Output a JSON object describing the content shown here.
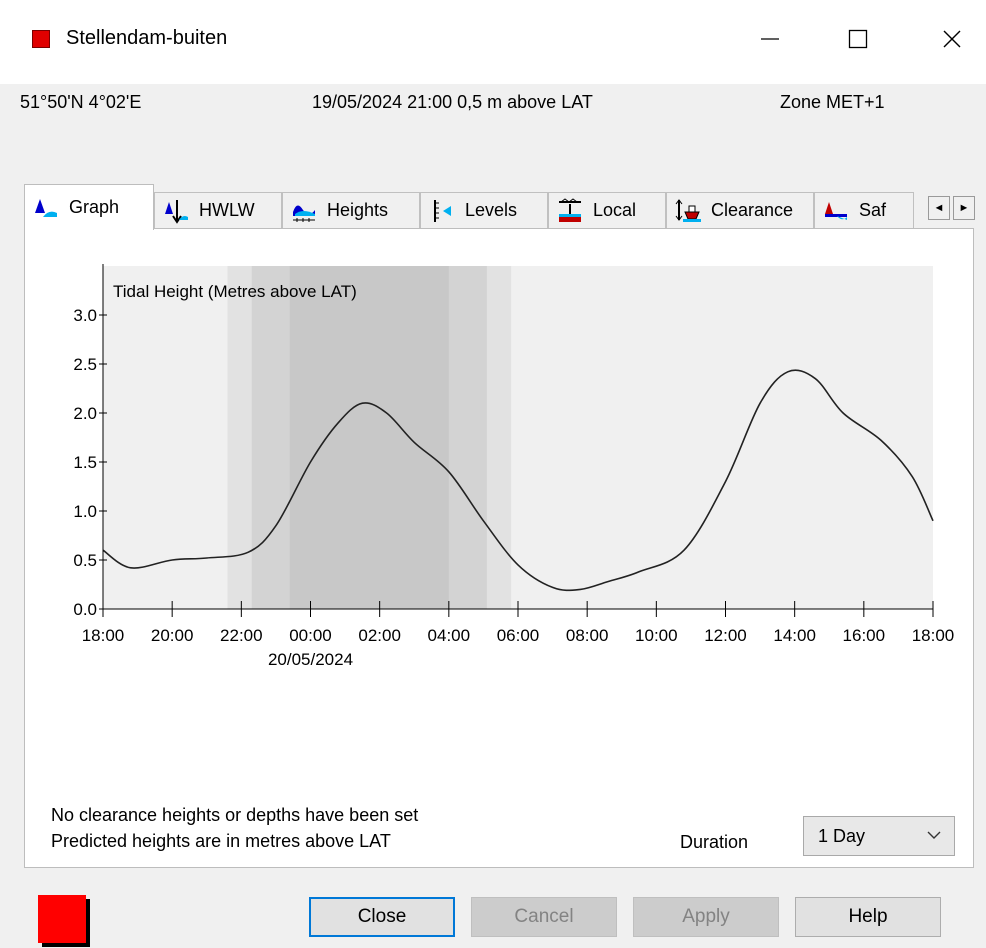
{
  "window": {
    "title": "Stellendam-buiten",
    "controls": {
      "minimize": "—",
      "maximize": "☐",
      "close": "✕"
    }
  },
  "info": {
    "position": "51°50'N 4°02'E",
    "datetime_height": "19/05/2024 21:00  0,5 m above LAT",
    "zone": "Zone  MET+1"
  },
  "tabs": [
    {
      "label": "Graph",
      "icon": "graph-icon",
      "active": true
    },
    {
      "label": "HWLW",
      "icon": "hwlw-icon"
    },
    {
      "label": "Heights",
      "icon": "heights-icon"
    },
    {
      "label": "Levels",
      "icon": "levels-icon"
    },
    {
      "label": "Local",
      "icon": "local-icon"
    },
    {
      "label": "Clearance",
      "icon": "clearance-icon"
    },
    {
      "label": "Saf",
      "icon": "safety-icon"
    }
  ],
  "tab_scroll": {
    "left": "◄",
    "right": "►"
  },
  "chart_data": {
    "type": "line",
    "title": "Tidal Height (Metres above LAT)",
    "ylim": [
      0,
      3.5
    ],
    "yticks": [
      "0.0",
      "0.5",
      "1.0",
      "1.5",
      "2.0",
      "2.5",
      "3.0"
    ],
    "ytick_values": [
      0,
      0.5,
      1.0,
      1.5,
      2.0,
      2.5,
      3.0
    ],
    "xlim": [
      0,
      24
    ],
    "xticks": [
      "18:00",
      "20:00",
      "22:00",
      "00:00",
      "02:00",
      "04:00",
      "06:00",
      "08:00",
      "10:00",
      "12:00",
      "14:00",
      "16:00",
      "18:00"
    ],
    "xtick_values": [
      0,
      2,
      4,
      6,
      8,
      10,
      12,
      14,
      16,
      18,
      20,
      22,
      24
    ],
    "date_label": "20/05/2024",
    "date_label_hours": 6,
    "shading_bands": [
      {
        "from_hours": 3.6,
        "to_hours": 11.8,
        "level": "light"
      },
      {
        "from_hours": 4.3,
        "to_hours": 11.1,
        "level": "medium"
      },
      {
        "from_hours": 5.4,
        "to_hours": 10.0,
        "level": "dark"
      }
    ],
    "grid": false,
    "series": [
      {
        "x_hours": [
          0,
          0.8,
          2,
          3,
          4.2,
          5,
          6,
          6.8,
          7.5,
          8.2,
          9,
          10,
          11,
          12,
          13,
          13.8,
          14.6,
          15.5,
          16.8,
          18,
          19,
          19.8,
          20.6,
          21.4,
          22.5,
          23.4,
          24
        ],
        "values": [
          0.6,
          0.42,
          0.5,
          0.52,
          0.58,
          0.85,
          1.5,
          1.9,
          2.1,
          2.0,
          1.7,
          1.4,
          0.9,
          0.45,
          0.22,
          0.2,
          0.28,
          0.38,
          0.6,
          1.3,
          2.1,
          2.42,
          2.35,
          2.0,
          1.72,
          1.35,
          0.9
        ]
      }
    ],
    "colors": {
      "line": "#222222",
      "plot_bg": "#f0f0f0",
      "light": "#e2e2e2",
      "medium": "#d3d3d3",
      "dark": "#c8c8c8"
    }
  },
  "notes": {
    "line1": "No clearance heights or depths have been set",
    "line2": "Predicted heights are in metres above LAT"
  },
  "duration": {
    "label": "Duration",
    "value": "1 Day"
  },
  "buttons": {
    "close": "Close",
    "cancel": "Cancel",
    "apply": "Apply",
    "help": "Help"
  },
  "colors": {
    "status_swatch": "#ff0000",
    "focus_border": "#0078d7"
  }
}
